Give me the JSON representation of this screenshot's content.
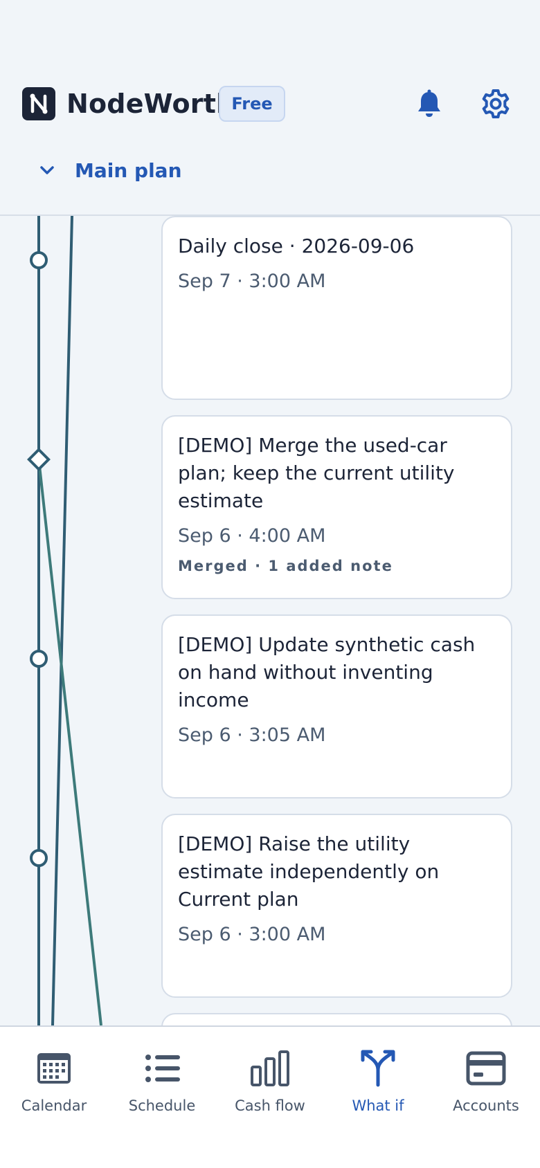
{
  "app": {
    "name": "NodeWorth",
    "plan_badge": "Free"
  },
  "plan_selector": {
    "current": "Main plan"
  },
  "commits": [
    {
      "title": "Daily close · 2026-09-06",
      "time": "Sep 7 · 3:00 AM",
      "note": ""
    },
    {
      "title": "[DEMO] Merge the used-car plan; keep the current utility estimate",
      "time": "Sep 6 · 4:00 AM",
      "note": "Merged · 1 added note"
    },
    {
      "title": "[DEMO] Update synthetic cash on hand without inventing income",
      "time": "Sep 6 · 3:05 AM",
      "note": ""
    },
    {
      "title": "[DEMO] Raise the utility estimate independently on Current plan",
      "time": "Sep 6 · 3:00 AM",
      "note": ""
    }
  ],
  "nav": {
    "items": [
      {
        "label": "Calendar",
        "icon": "calendar-icon"
      },
      {
        "label": "Schedule",
        "icon": "list-icon"
      },
      {
        "label": "Cash flow",
        "icon": "bar-chart-icon"
      },
      {
        "label": "What if",
        "icon": "branch-icon",
        "active": true
      },
      {
        "label": "Accounts",
        "icon": "card-icon"
      }
    ]
  },
  "colors": {
    "accent": "#2458b4",
    "graph_main": "#2f5d73",
    "graph_branch": "#3d7a7a"
  }
}
